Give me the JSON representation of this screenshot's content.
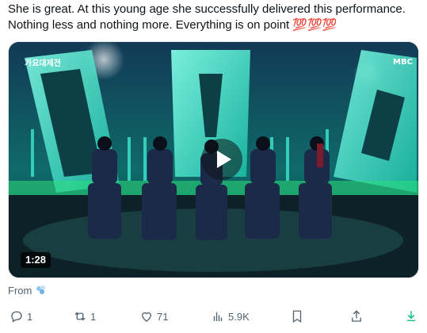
{
  "tweet": {
    "text_line1": "She is great. At this young age she successfully delivered this performance.",
    "text_line2": "Nothing less and nothing more. Everything is on point",
    "emoji": "💯💯💯"
  },
  "video": {
    "duration": "1:28",
    "broadcast_logo": "MBC",
    "show_logo": "가요대제전"
  },
  "source": {
    "label": "From"
  },
  "actions": {
    "reply_count": "1",
    "repost_count": "1",
    "like_count": "71",
    "views_count": "5.9K"
  },
  "colors": {
    "text": "#0f1419",
    "muted": "#536471",
    "download_green": "#00ba7c",
    "stage_cyan": "#2ee8c8"
  },
  "icons": [
    "reply-icon",
    "repost-icon",
    "like-icon",
    "views-icon",
    "bookmark-icon",
    "share-icon",
    "download-icon",
    "play-icon"
  ]
}
